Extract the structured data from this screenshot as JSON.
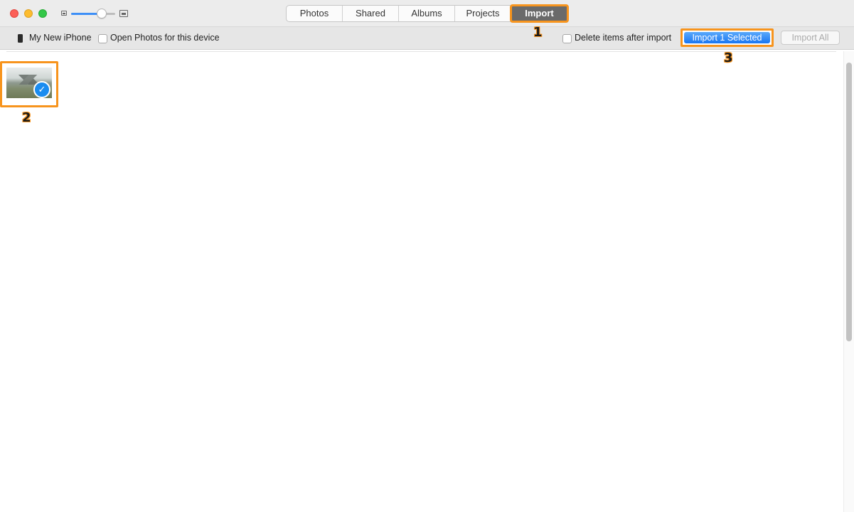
{
  "titlebar": {
    "zoom_level": 0.7,
    "tabs": [
      {
        "label": "Photos",
        "active": false
      },
      {
        "label": "Shared",
        "active": false
      },
      {
        "label": "Albums",
        "active": false
      },
      {
        "label": "Projects",
        "active": false
      },
      {
        "label": "Import",
        "active": true
      }
    ]
  },
  "toolbar": {
    "device_name": "My New iPhone",
    "open_photos_label": "Open Photos for this device",
    "open_photos_checked": false,
    "delete_label": "Delete items after import",
    "delete_checked": false,
    "import_selected_label": "Import 1 Selected",
    "import_all_label": "Import All"
  },
  "content": {
    "thumbnails": [
      {
        "selected": true,
        "check_icon": "✓"
      }
    ]
  },
  "annotations": {
    "step_1": "1",
    "step_2": "2",
    "step_3": "3",
    "highlight_color": "#f7941d"
  },
  "colors": {
    "accent_blue": "#1a8cf0",
    "active_tab": "#6a6a6a"
  }
}
